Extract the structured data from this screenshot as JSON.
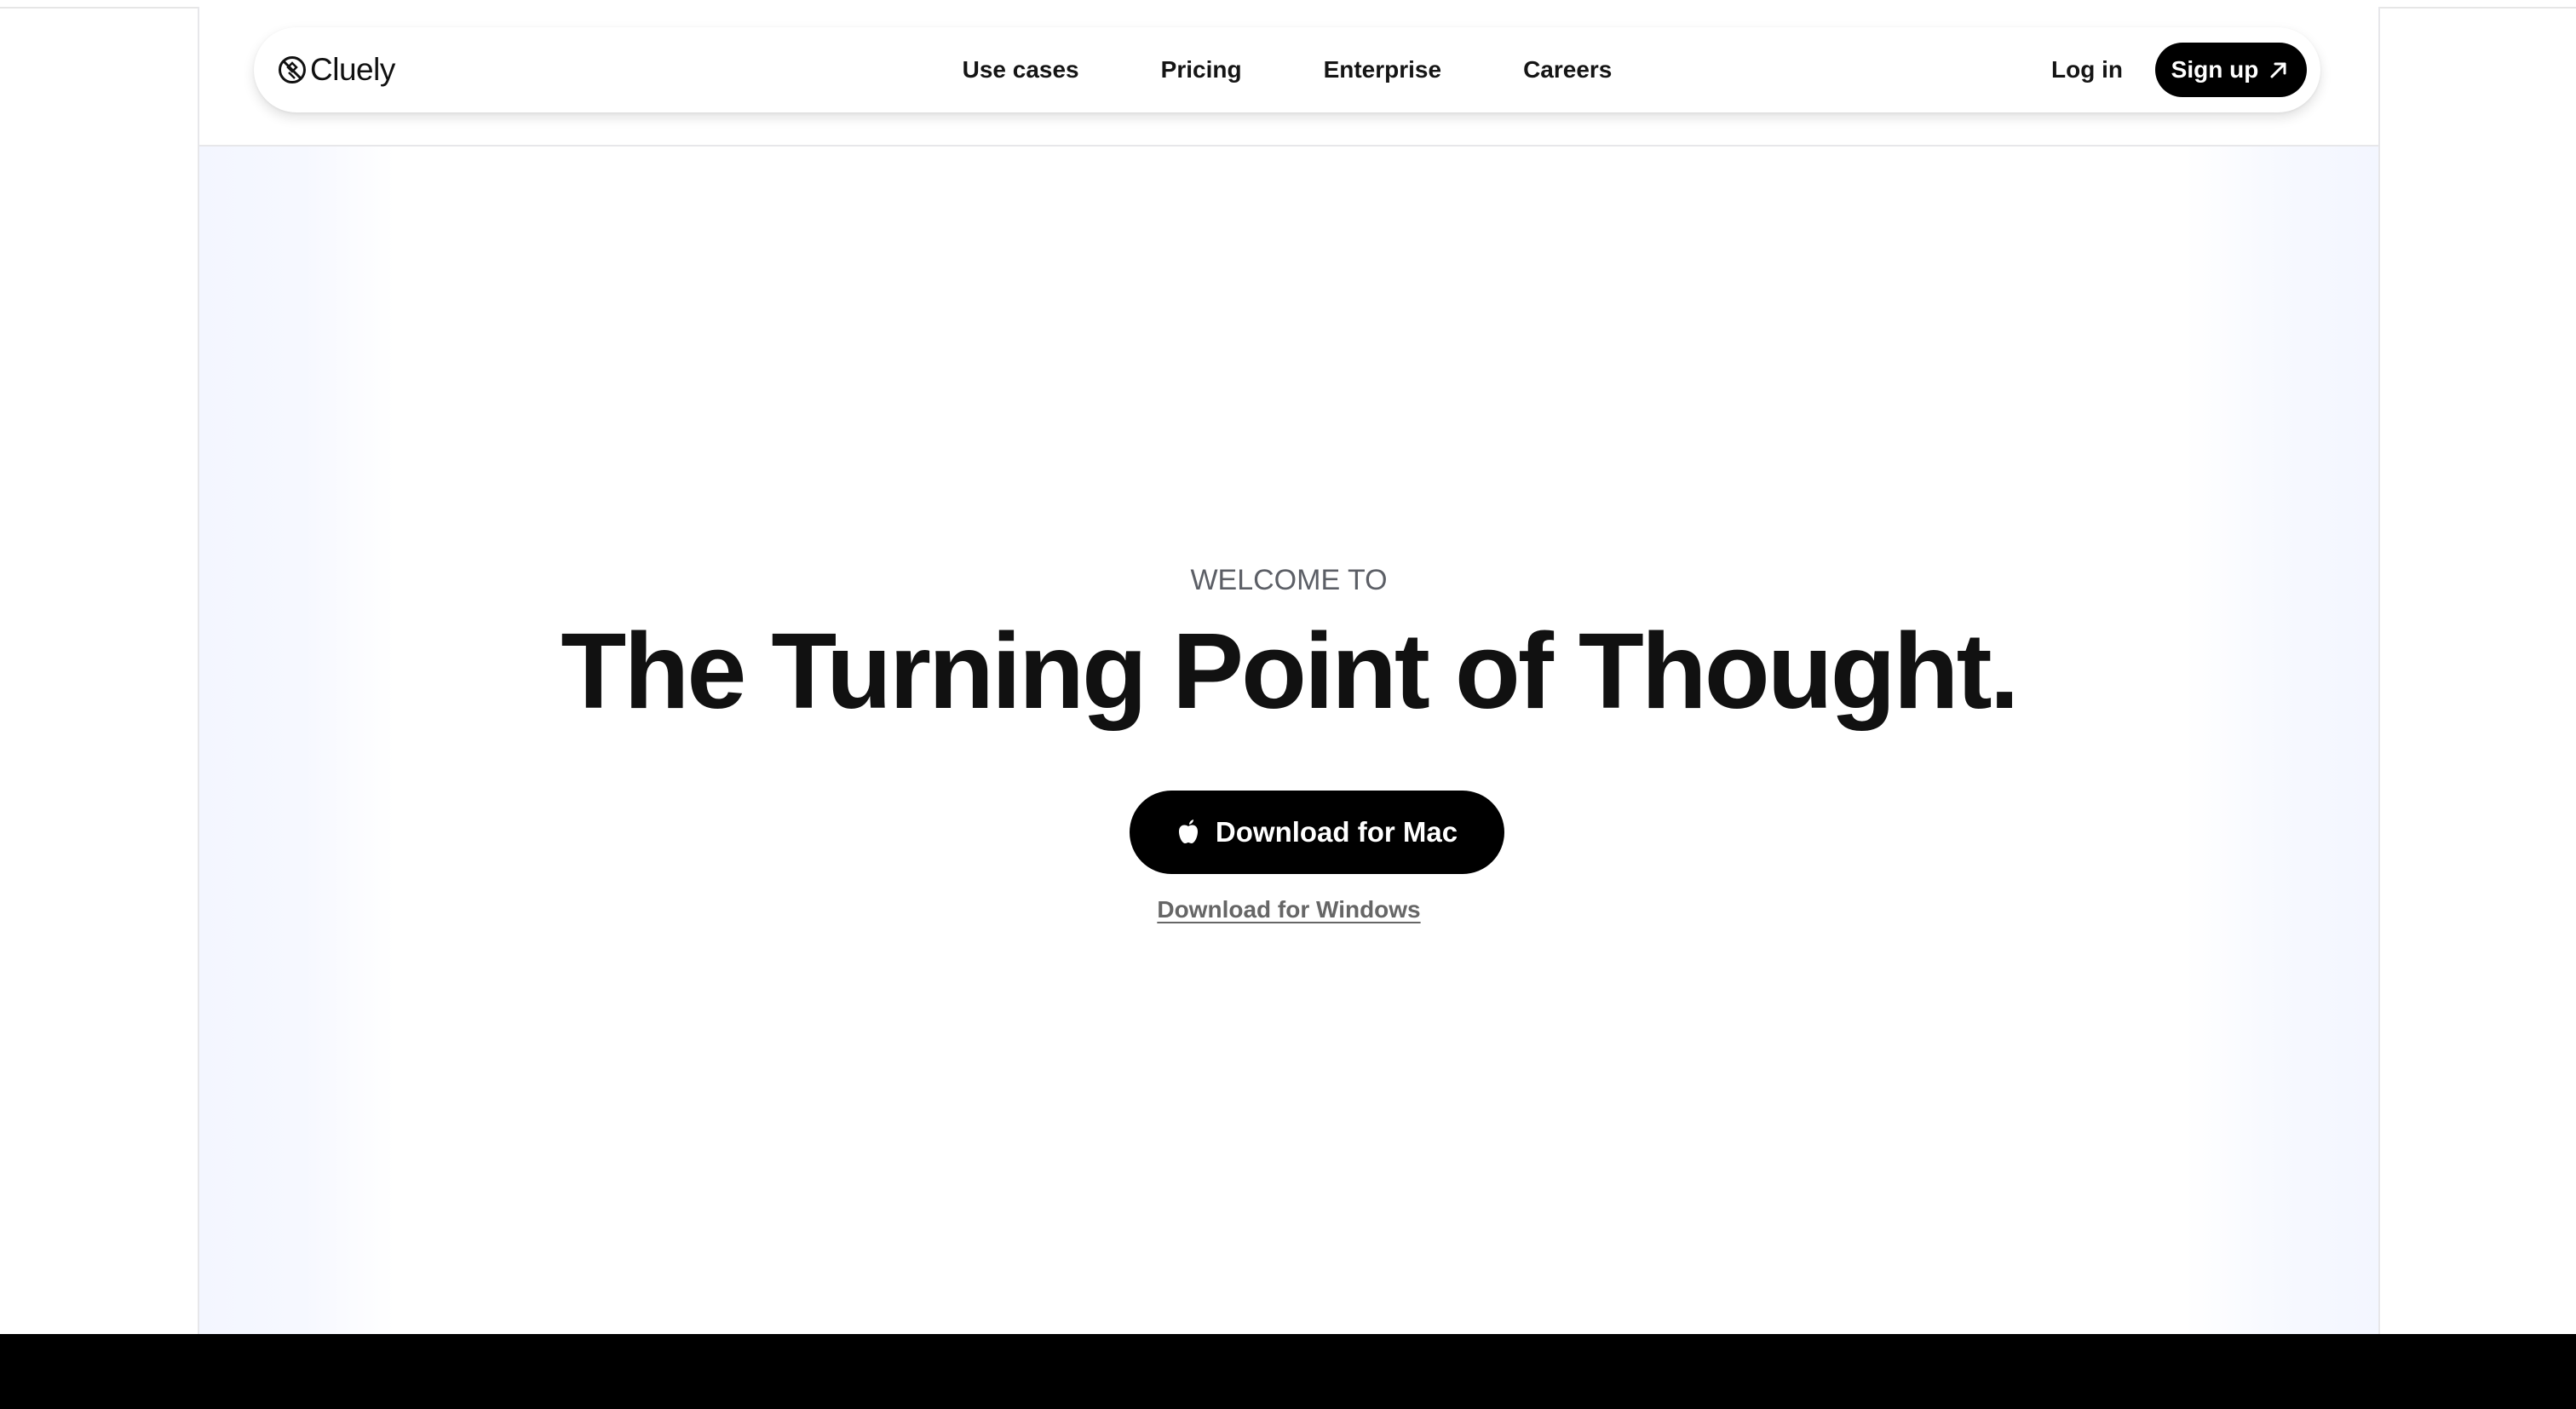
{
  "header": {
    "brand_name": "Cluely",
    "nav": [
      {
        "label": "Use cases"
      },
      {
        "label": "Pricing"
      },
      {
        "label": "Enterprise"
      },
      {
        "label": "Careers"
      }
    ],
    "login_label": "Log in",
    "signup_label": "Sign up"
  },
  "hero": {
    "eyebrow": "WELCOME TO",
    "headline": "The Turning Point of Thought.",
    "mac_button_label": "Download for Mac",
    "windows_link_label": "Download for Windows"
  },
  "icons": {
    "brand": "cluely-logo-icon",
    "signup": "arrow-up-right-icon",
    "mac": "apple-icon"
  },
  "colors": {
    "primary_button": "#000000",
    "hero_gradient_edge": "#f3f6ff",
    "secondary_text": "#666666"
  }
}
